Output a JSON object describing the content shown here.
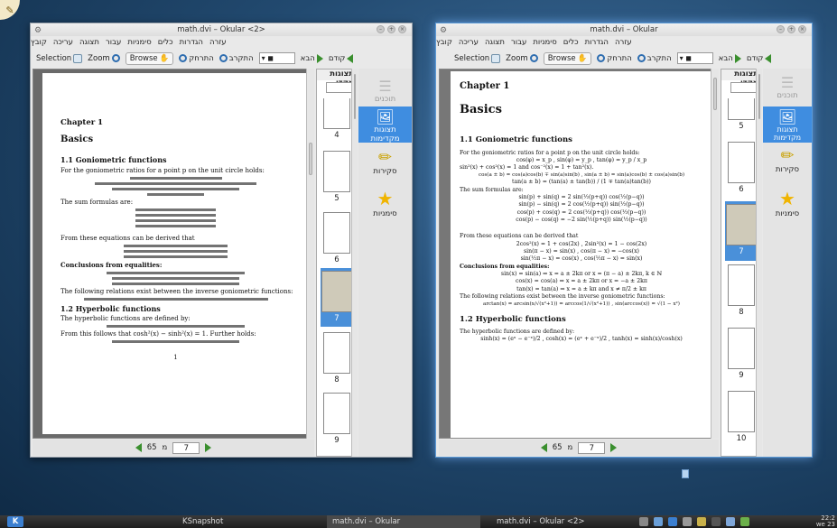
{
  "desktop": {
    "taskbar": {
      "tasks": [
        "KSnapshot",
        "math.dvi – Okular",
        "math.dvi – Okular <2>"
      ],
      "clock_time": "22:2",
      "clock_date": "we 23"
    }
  },
  "windows": [
    {
      "title": "math.dvi – Okular <2>",
      "menu": [
        "קובץ",
        "עריכה",
        "תצוגה",
        "עבור",
        "סימניות",
        "כלים",
        "הגדרות",
        "עזרה"
      ],
      "toolbar": {
        "prev": "קודם",
        "next": "הבא",
        "zoom_in": "התקרב",
        "zoom_out": "התרחק",
        "browse": "Browse",
        "zoom": "Zoom",
        "selection": "Selection"
      },
      "thumb_header": "תצוגות מקדי",
      "thumb_numbers": [
        "4",
        "5",
        "6",
        "7",
        "8",
        "9"
      ],
      "selected_thumb": "7",
      "sidebar": [
        "תוכנים",
        "תצוגות מקדימות",
        "סקירות",
        "סימניות"
      ],
      "nav": {
        "current_page": "7",
        "of_label": "מ",
        "total": "65"
      },
      "page": {
        "chapter": "Chapter 1",
        "title": "Basics",
        "s1": "1.1 Goniometric functions",
        "s1_text": "For the goniometric ratios for a point p on the unit circle holds:",
        "sum_text": "The sum formulas are:",
        "derived_text": "From these equations can be derived that",
        "conclusions": "Conclusions from equalities:",
        "inverse_text": "The following relations exist between the inverse goniometric functions:",
        "s2": "1.2 Hyperbolic functions",
        "s2_text": "The hyperbolic functions are defined by:",
        "s2_follow": "From this follows that cosh²(x) − sinh²(x) = 1. Further holds:",
        "page_number": "1"
      }
    },
    {
      "title": "math.dvi – Okular",
      "menu": [
        "קובץ",
        "עריכה",
        "תצוגה",
        "עבור",
        "סימניות",
        "כלים",
        "הגדרות",
        "עזרה"
      ],
      "toolbar": {
        "prev": "קודם",
        "next": "הבא",
        "zoom_in": "התקרב",
        "zoom_out": "התרחק",
        "browse": "Browse",
        "zoom": "Zoom",
        "selection": "Selection"
      },
      "thumb_header": "תצוגות מקדי",
      "thumb_numbers": [
        "5",
        "6",
        "7",
        "8",
        "9",
        "10"
      ],
      "selected_thumb": "7",
      "sidebar": [
        "תוכנים",
        "תצוגות מקדימות",
        "סקירות",
        "סימניות"
      ],
      "nav": {
        "current_page": "7",
        "of_label": "מ",
        "total": "65"
      },
      "page": {
        "chapter": "Chapter 1",
        "title": "Basics",
        "s1": "1.1 Goniometric functions",
        "s1_text": "For the goniometric ratios for a point p on the unit circle holds:",
        "m1": "cos(φ) = x_p ,  sin(φ) = y_p ,  tan(φ) = y_p / x_p",
        "m2": "sin²(x) + cos²(x) = 1 and cos⁻²(x) = 1 + tan²(x).",
        "m3": "cos(a ± b) = cos(a)cos(b) ∓ sin(a)sin(b) ,  sin(a ± b) = sin(a)cos(b) ± cos(a)sin(b)",
        "m4": "tan(a ± b) = (tan(a) ± tan(b)) / (1 ∓ tan(a)tan(b))",
        "sum_text": "The sum formulas are:",
        "sum": [
          "sin(p) + sin(q)  =  2 sin(½(p+q)) cos(½(p−q))",
          "sin(p) − sin(q)  =  2 cos(½(p+q)) sin(½(p−q))",
          "cos(p) + cos(q)  =  2 cos(½(p+q)) cos(½(p−q))",
          "cos(p) − cos(q)  =  −2 sin(½(p+q)) sin(½(p−q))"
        ],
        "derived_text": "From these equations can be derived that",
        "der": [
          "2cos²(x) = 1 + cos(2x)  ,  2sin²(x) = 1 − cos(2x)",
          "sin(π − x) = sin(x)  ,  cos(π − x) = −cos(x)",
          "sin(½π − x) = cos(x)  ,  cos(½π − x) = sin(x)"
        ],
        "conclusions": "Conclusions from equalities:",
        "conc": [
          "sin(x) = sin(a)  ⇒  x = a ± 2kπ or x = (π − a) ± 2kπ,  k ∈ ℕ",
          "cos(x) = cos(a)  ⇒  x = a ± 2kπ or x = −a ± 2kπ",
          "tan(x) = tan(a)  ⇒  x = a ± kπ and x ≠ π/2 ± kπ"
        ],
        "inverse_text": "The following relations exist between the inverse goniometric functions:",
        "inv": "arctan(x) = arcsin(x/√(x²+1)) = arccos(1/√(x²+1)) ,  sin(arccos(x)) = √(1 − x²)",
        "s2": "1.2 Hyperbolic functions",
        "s2_text": "The hyperbolic functions are defined by:",
        "hyp": "sinh(x) = (eˣ − e⁻ˣ)/2 ,  cosh(x) = (eˣ + e⁻ˣ)/2 ,  tanh(x) = sinh(x)/cosh(x)"
      }
    }
  ]
}
